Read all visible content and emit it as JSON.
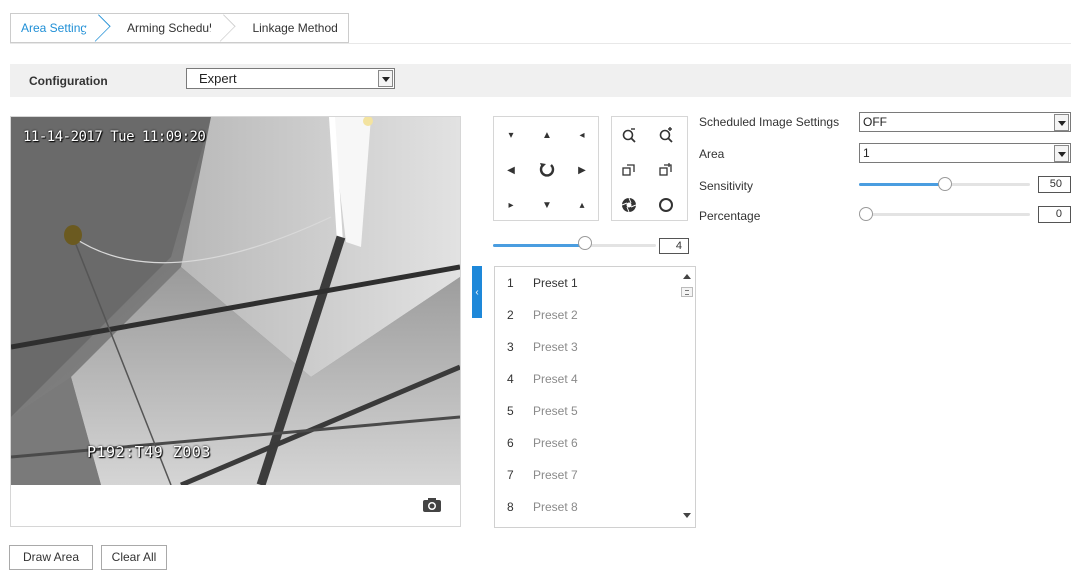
{
  "tabs": [
    {
      "label": "Area Settings",
      "active": true
    },
    {
      "label": "Arming Schedule",
      "active": false
    },
    {
      "label": "Linkage Method",
      "active": false
    }
  ],
  "configuration": {
    "label": "Configuration",
    "value": "Expert"
  },
  "video": {
    "osd_top": "11-14-2017 Tue 11:09:20",
    "osd_bottom": "P192:T49  Z003",
    "snapshot_icon": "camera-icon"
  },
  "ptz": {
    "buttons": [
      "up-left-icon",
      "up-icon",
      "up-right-icon",
      "left-icon",
      "auto-rotate-icon",
      "right-icon",
      "down-left-icon",
      "down-icon",
      "down-right-icon",
      "zoom-out-icon",
      "zoom-in-icon",
      "focus-near-icon",
      "focus-far-icon",
      "iris-close-icon",
      "iris-open-icon"
    ],
    "speed": 4,
    "speed_max": 7
  },
  "presets": [
    {
      "num": "1",
      "name": "Preset 1"
    },
    {
      "num": "2",
      "name": "Preset 2"
    },
    {
      "num": "3",
      "name": "Preset 3"
    },
    {
      "num": "4",
      "name": "Preset 4"
    },
    {
      "num": "5",
      "name": "Preset 5"
    },
    {
      "num": "6",
      "name": "Preset 6"
    },
    {
      "num": "7",
      "name": "Preset 7"
    },
    {
      "num": "8",
      "name": "Preset 8"
    }
  ],
  "settings": {
    "scheduled_label": "Scheduled Image Settings",
    "scheduled_value": "OFF",
    "area_label": "Area",
    "area_value": "1",
    "sensitivity_label": "Sensitivity",
    "sensitivity_value": "50",
    "percentage_label": "Percentage",
    "percentage_value": "0"
  },
  "actions": {
    "draw_area": "Draw Area",
    "clear_all": "Clear All"
  },
  "colors": {
    "accent": "#1f8fd6",
    "slider_fill": "#4a9de0"
  }
}
